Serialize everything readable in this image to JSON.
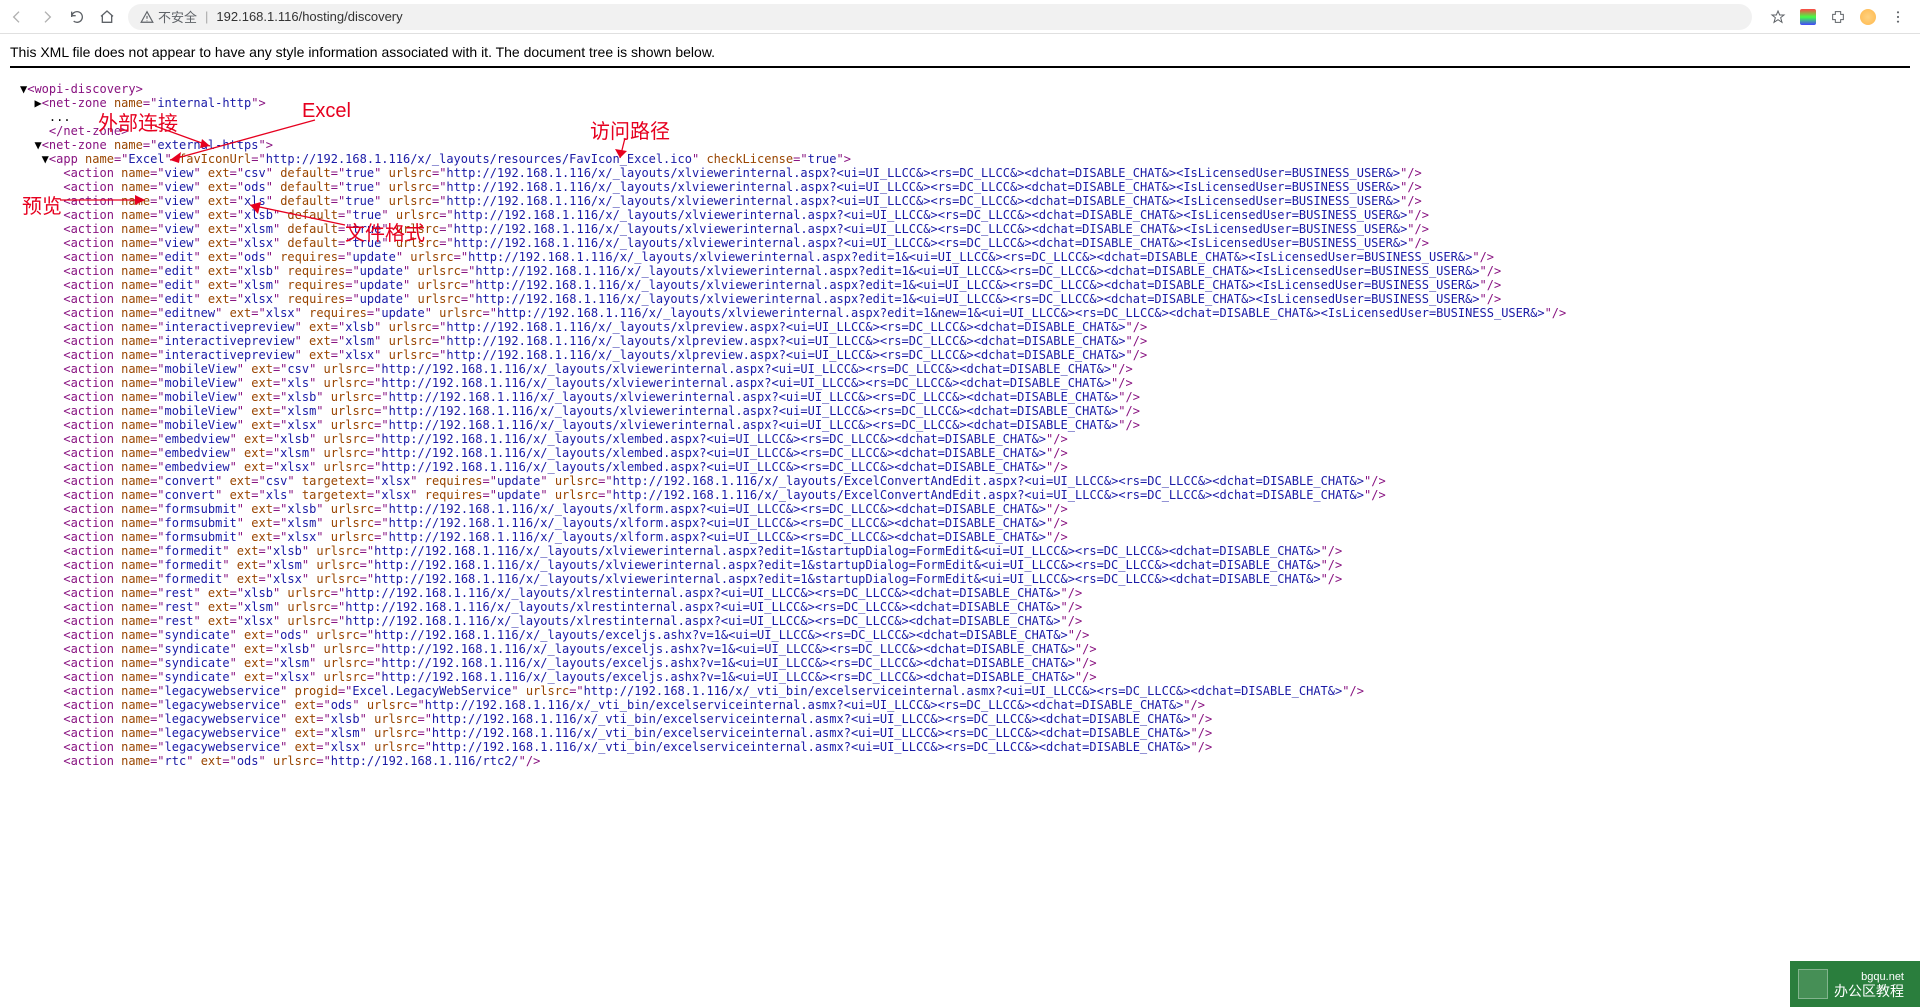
{
  "toolbar": {
    "url_insecure_label": "不安全",
    "url": "192.168.1.116/hosting/discovery"
  },
  "banner": "This XML file does not appear to have any style information associated with it. The document tree is shown below.",
  "annotations": {
    "external_link": "外部连接",
    "excel": "Excel",
    "access_path": "访问路径",
    "preview": "预览",
    "file_format": "文件格式"
  },
  "xml": {
    "root": "wopi-discovery",
    "netzone_internal": "internal-http",
    "netzone_external": "external-https",
    "app_name": "Excel",
    "favicon": "http://192.168.1.116/x/_layouts/resources/FavIcon_Excel.ico",
    "checkLicense": "true",
    "actions": [
      {
        "name": "view",
        "ext": "csv",
        "default": "true",
        "urlsrc": "http://192.168.1.116/x/_layouts/xlviewerinternal.aspx?<ui=UI_LLCC&><rs=DC_LLCC&><dchat=DISABLE_CHAT&><IsLicensedUser=BUSINESS_USER&>"
      },
      {
        "name": "view",
        "ext": "ods",
        "default": "true",
        "urlsrc": "http://192.168.1.116/x/_layouts/xlviewerinternal.aspx?<ui=UI_LLCC&><rs=DC_LLCC&><dchat=DISABLE_CHAT&><IsLicensedUser=BUSINESS_USER&>"
      },
      {
        "name": "view",
        "ext": "xls",
        "default": "true",
        "urlsrc": "http://192.168.1.116/x/_layouts/xlviewerinternal.aspx?<ui=UI_LLCC&><rs=DC_LLCC&><dchat=DISABLE_CHAT&><IsLicensedUser=BUSINESS_USER&>"
      },
      {
        "name": "view",
        "ext": "xlsb",
        "default": "true",
        "urlsrc": "http://192.168.1.116/x/_layouts/xlviewerinternal.aspx?<ui=UI_LLCC&><rs=DC_LLCC&><dchat=DISABLE_CHAT&><IsLicensedUser=BUSINESS_USER&>"
      },
      {
        "name": "view",
        "ext": "xlsm",
        "default": "true",
        "urlsrc": "http://192.168.1.116/x/_layouts/xlviewerinternal.aspx?<ui=UI_LLCC&><rs=DC_LLCC&><dchat=DISABLE_CHAT&><IsLicensedUser=BUSINESS_USER&>"
      },
      {
        "name": "view",
        "ext": "xlsx",
        "default": "true",
        "urlsrc": "http://192.168.1.116/x/_layouts/xlviewerinternal.aspx?<ui=UI_LLCC&><rs=DC_LLCC&><dchat=DISABLE_CHAT&><IsLicensedUser=BUSINESS_USER&>"
      },
      {
        "name": "edit",
        "ext": "ods",
        "requires": "update",
        "urlsrc": "http://192.168.1.116/x/_layouts/xlviewerinternal.aspx?edit=1&<ui=UI_LLCC&><rs=DC_LLCC&><dchat=DISABLE_CHAT&><IsLicensedUser=BUSINESS_USER&>"
      },
      {
        "name": "edit",
        "ext": "xlsb",
        "requires": "update",
        "urlsrc": "http://192.168.1.116/x/_layouts/xlviewerinternal.aspx?edit=1&<ui=UI_LLCC&><rs=DC_LLCC&><dchat=DISABLE_CHAT&><IsLicensedUser=BUSINESS_USER&>"
      },
      {
        "name": "edit",
        "ext": "xlsm",
        "requires": "update",
        "urlsrc": "http://192.168.1.116/x/_layouts/xlviewerinternal.aspx?edit=1&<ui=UI_LLCC&><rs=DC_LLCC&><dchat=DISABLE_CHAT&><IsLicensedUser=BUSINESS_USER&>"
      },
      {
        "name": "edit",
        "ext": "xlsx",
        "requires": "update",
        "urlsrc": "http://192.168.1.116/x/_layouts/xlviewerinternal.aspx?edit=1&<ui=UI_LLCC&><rs=DC_LLCC&><dchat=DISABLE_CHAT&><IsLicensedUser=BUSINESS_USER&>"
      },
      {
        "name": "editnew",
        "ext": "xlsx",
        "requires": "update",
        "urlsrc": "http://192.168.1.116/x/_layouts/xlviewerinternal.aspx?edit=1&new=1&<ui=UI_LLCC&><rs=DC_LLCC&><dchat=DISABLE_CHAT&><IsLicensedUser=BUSINESS_USER&>"
      },
      {
        "name": "interactivepreview",
        "ext": "xlsb",
        "urlsrc": "http://192.168.1.116/x/_layouts/xlpreview.aspx?<ui=UI_LLCC&><rs=DC_LLCC&><dchat=DISABLE_CHAT&>"
      },
      {
        "name": "interactivepreview",
        "ext": "xlsm",
        "urlsrc": "http://192.168.1.116/x/_layouts/xlpreview.aspx?<ui=UI_LLCC&><rs=DC_LLCC&><dchat=DISABLE_CHAT&>"
      },
      {
        "name": "interactivepreview",
        "ext": "xlsx",
        "urlsrc": "http://192.168.1.116/x/_layouts/xlpreview.aspx?<ui=UI_LLCC&><rs=DC_LLCC&><dchat=DISABLE_CHAT&>"
      },
      {
        "name": "mobileView",
        "ext": "csv",
        "urlsrc": "http://192.168.1.116/x/_layouts/xlviewerinternal.aspx?<ui=UI_LLCC&><rs=DC_LLCC&><dchat=DISABLE_CHAT&>"
      },
      {
        "name": "mobileView",
        "ext": "xls",
        "urlsrc": "http://192.168.1.116/x/_layouts/xlviewerinternal.aspx?<ui=UI_LLCC&><rs=DC_LLCC&><dchat=DISABLE_CHAT&>"
      },
      {
        "name": "mobileView",
        "ext": "xlsb",
        "urlsrc": "http://192.168.1.116/x/_layouts/xlviewerinternal.aspx?<ui=UI_LLCC&><rs=DC_LLCC&><dchat=DISABLE_CHAT&>"
      },
      {
        "name": "mobileView",
        "ext": "xlsm",
        "urlsrc": "http://192.168.1.116/x/_layouts/xlviewerinternal.aspx?<ui=UI_LLCC&><rs=DC_LLCC&><dchat=DISABLE_CHAT&>"
      },
      {
        "name": "mobileView",
        "ext": "xlsx",
        "urlsrc": "http://192.168.1.116/x/_layouts/xlviewerinternal.aspx?<ui=UI_LLCC&><rs=DC_LLCC&><dchat=DISABLE_CHAT&>"
      },
      {
        "name": "embedview",
        "ext": "xlsb",
        "urlsrc": "http://192.168.1.116/x/_layouts/xlembed.aspx?<ui=UI_LLCC&><rs=DC_LLCC&><dchat=DISABLE_CHAT&>"
      },
      {
        "name": "embedview",
        "ext": "xlsm",
        "urlsrc": "http://192.168.1.116/x/_layouts/xlembed.aspx?<ui=UI_LLCC&><rs=DC_LLCC&><dchat=DISABLE_CHAT&>"
      },
      {
        "name": "embedview",
        "ext": "xlsx",
        "urlsrc": "http://192.168.1.116/x/_layouts/xlembed.aspx?<ui=UI_LLCC&><rs=DC_LLCC&><dchat=DISABLE_CHAT&>"
      },
      {
        "name": "convert",
        "ext": "csv",
        "targetext": "xlsx",
        "requires": "update",
        "urlsrc": "http://192.168.1.116/x/_layouts/ExcelConvertAndEdit.aspx?<ui=UI_LLCC&><rs=DC_LLCC&><dchat=DISABLE_CHAT&>"
      },
      {
        "name": "convert",
        "ext": "xls",
        "targetext": "xlsx",
        "requires": "update",
        "urlsrc": "http://192.168.1.116/x/_layouts/ExcelConvertAndEdit.aspx?<ui=UI_LLCC&><rs=DC_LLCC&><dchat=DISABLE_CHAT&>"
      },
      {
        "name": "formsubmit",
        "ext": "xlsb",
        "urlsrc": "http://192.168.1.116/x/_layouts/xlform.aspx?<ui=UI_LLCC&><rs=DC_LLCC&><dchat=DISABLE_CHAT&>"
      },
      {
        "name": "formsubmit",
        "ext": "xlsm",
        "urlsrc": "http://192.168.1.116/x/_layouts/xlform.aspx?<ui=UI_LLCC&><rs=DC_LLCC&><dchat=DISABLE_CHAT&>"
      },
      {
        "name": "formsubmit",
        "ext": "xlsx",
        "urlsrc": "http://192.168.1.116/x/_layouts/xlform.aspx?<ui=UI_LLCC&><rs=DC_LLCC&><dchat=DISABLE_CHAT&>"
      },
      {
        "name": "formedit",
        "ext": "xlsb",
        "urlsrc": "http://192.168.1.116/x/_layouts/xlviewerinternal.aspx?edit=1&startupDialog=FormEdit&<ui=UI_LLCC&><rs=DC_LLCC&><dchat=DISABLE_CHAT&>"
      },
      {
        "name": "formedit",
        "ext": "xlsm",
        "urlsrc": "http://192.168.1.116/x/_layouts/xlviewerinternal.aspx?edit=1&startupDialog=FormEdit&<ui=UI_LLCC&><rs=DC_LLCC&><dchat=DISABLE_CHAT&>"
      },
      {
        "name": "formedit",
        "ext": "xlsx",
        "urlsrc": "http://192.168.1.116/x/_layouts/xlviewerinternal.aspx?edit=1&startupDialog=FormEdit&<ui=UI_LLCC&><rs=DC_LLCC&><dchat=DISABLE_CHAT&>"
      },
      {
        "name": "rest",
        "ext": "xlsb",
        "urlsrc": "http://192.168.1.116/x/_layouts/xlrestinternal.aspx?<ui=UI_LLCC&><rs=DC_LLCC&><dchat=DISABLE_CHAT&>"
      },
      {
        "name": "rest",
        "ext": "xlsm",
        "urlsrc": "http://192.168.1.116/x/_layouts/xlrestinternal.aspx?<ui=UI_LLCC&><rs=DC_LLCC&><dchat=DISABLE_CHAT&>"
      },
      {
        "name": "rest",
        "ext": "xlsx",
        "urlsrc": "http://192.168.1.116/x/_layouts/xlrestinternal.aspx?<ui=UI_LLCC&><rs=DC_LLCC&><dchat=DISABLE_CHAT&>"
      },
      {
        "name": "syndicate",
        "ext": "ods",
        "urlsrc": "http://192.168.1.116/x/_layouts/exceljs.ashx?v=1&<ui=UI_LLCC&><rs=DC_LLCC&><dchat=DISABLE_CHAT&>"
      },
      {
        "name": "syndicate",
        "ext": "xlsb",
        "urlsrc": "http://192.168.1.116/x/_layouts/exceljs.ashx?v=1&<ui=UI_LLCC&><rs=DC_LLCC&><dchat=DISABLE_CHAT&>"
      },
      {
        "name": "syndicate",
        "ext": "xlsm",
        "urlsrc": "http://192.168.1.116/x/_layouts/exceljs.ashx?v=1&<ui=UI_LLCC&><rs=DC_LLCC&><dchat=DISABLE_CHAT&>"
      },
      {
        "name": "syndicate",
        "ext": "xlsx",
        "urlsrc": "http://192.168.1.116/x/_layouts/exceljs.ashx?v=1&<ui=UI_LLCC&><rs=DC_LLCC&><dchat=DISABLE_CHAT&>"
      },
      {
        "name": "legacywebservice",
        "progid": "Excel.LegacyWebService",
        "urlsrc": "http://192.168.1.116/x/_vti_bin/excelserviceinternal.asmx?<ui=UI_LLCC&><rs=DC_LLCC&><dchat=DISABLE_CHAT&>"
      },
      {
        "name": "legacywebservice",
        "ext": "ods",
        "urlsrc": "http://192.168.1.116/x/_vti_bin/excelserviceinternal.asmx?<ui=UI_LLCC&><rs=DC_LLCC&><dchat=DISABLE_CHAT&>"
      },
      {
        "name": "legacywebservice",
        "ext": "xlsb",
        "urlsrc": "http://192.168.1.116/x/_vti_bin/excelserviceinternal.asmx?<ui=UI_LLCC&><rs=DC_LLCC&><dchat=DISABLE_CHAT&>"
      },
      {
        "name": "legacywebservice",
        "ext": "xlsm",
        "urlsrc": "http://192.168.1.116/x/_vti_bin/excelserviceinternal.asmx?<ui=UI_LLCC&><rs=DC_LLCC&><dchat=DISABLE_CHAT&>"
      },
      {
        "name": "legacywebservice",
        "ext": "xlsx",
        "urlsrc": "http://192.168.1.116/x/_vti_bin/excelserviceinternal.asmx?<ui=UI_LLCC&><rs=DC_LLCC&><dchat=DISABLE_CHAT&>"
      },
      {
        "name": "rtc",
        "ext": "ods",
        "urlsrc": "http://192.168.1.116/rtc2/"
      }
    ]
  },
  "watermark": {
    "site": "bgqu.net",
    "label": "办公区教程"
  }
}
